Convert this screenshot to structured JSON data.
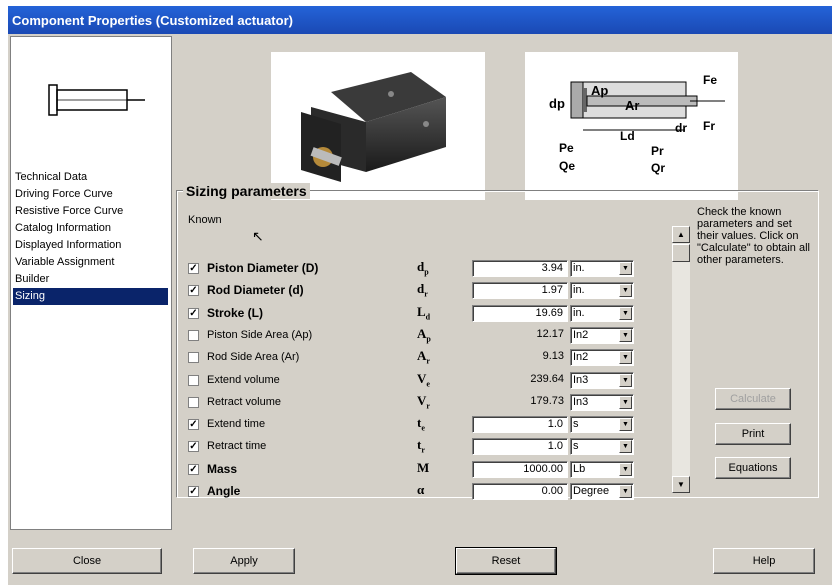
{
  "window": {
    "title": "Component Properties (Customized actuator)"
  },
  "nav": {
    "items": [
      "Technical Data",
      "Driving Force Curve",
      "Resistive Force Curve",
      "Catalog Information",
      "Displayed Information",
      "Variable Assignment",
      "Builder",
      "Sizing"
    ],
    "selected": "Sizing"
  },
  "diagram": {
    "dp": "dp",
    "Ap": "Ap",
    "Ar": "Ar",
    "Fe": "Fe",
    "Fr": "Fr",
    "dr": "dr",
    "Ld": "Ld",
    "Pe": "Pe",
    "Qe": "Qe",
    "Pr": "Pr",
    "Qr": "Qr"
  },
  "sizing": {
    "title": "Sizing parameters",
    "known_label": "Known",
    "help_text": "Check the known parameters and set their values. Click on \"Calculate\" to obtain all other parameters.",
    "rows": [
      {
        "label": "Piston Diameter (D)",
        "checked": true,
        "bold": true,
        "sym": "d",
        "sub": "p",
        "value": "3.94",
        "unit": "in.",
        "editable": true
      },
      {
        "label": "Rod Diameter (d)",
        "checked": true,
        "bold": true,
        "sym": "d",
        "sub": "r",
        "value": "1.97",
        "unit": "in.",
        "editable": true
      },
      {
        "label": "Stroke (L)",
        "checked": true,
        "bold": true,
        "sym": "L",
        "sub": "d",
        "value": "19.69",
        "unit": "in.",
        "editable": true
      },
      {
        "label": "Piston Side Area (Ap)",
        "checked": false,
        "bold": false,
        "sym": "A",
        "sub": "p",
        "value": "12.17",
        "unit": "In2",
        "editable": false
      },
      {
        "label": "Rod Side Area (Ar)",
        "checked": false,
        "bold": false,
        "sym": "A",
        "sub": "r",
        "value": "9.13",
        "unit": "In2",
        "editable": false
      },
      {
        "label": "Extend volume",
        "checked": false,
        "bold": false,
        "sym": "V",
        "sub": "e",
        "value": "239.64",
        "unit": "In3",
        "editable": false
      },
      {
        "label": "Retract volume",
        "checked": false,
        "bold": false,
        "sym": "V",
        "sub": "r",
        "value": "179.73",
        "unit": "In3",
        "editable": false
      },
      {
        "label": "Extend time",
        "checked": true,
        "bold": false,
        "sym": "t",
        "sub": "e",
        "value": "1.0",
        "unit": "s",
        "editable": true
      },
      {
        "label": "Retract time",
        "checked": true,
        "bold": false,
        "sym": "t",
        "sub": "r",
        "value": "1.0",
        "unit": "s",
        "editable": true
      },
      {
        "label": "Mass",
        "checked": true,
        "bold": true,
        "sym": "M",
        "sub": "",
        "value": "1000.00",
        "unit": "Lb",
        "editable": true
      },
      {
        "label": "Angle",
        "checked": true,
        "bold": true,
        "sym": "α",
        "sub": "",
        "value": "0.00",
        "unit": "Degree",
        "editable": true
      }
    ]
  },
  "buttons": {
    "calculate": "Calculate",
    "print": "Print",
    "equations": "Equations",
    "close": "Close",
    "apply": "Apply",
    "reset": "Reset",
    "help": "Help"
  },
  "icons": {
    "check": "✓",
    "arrow_down": "▼",
    "arrow_up": "▲"
  }
}
